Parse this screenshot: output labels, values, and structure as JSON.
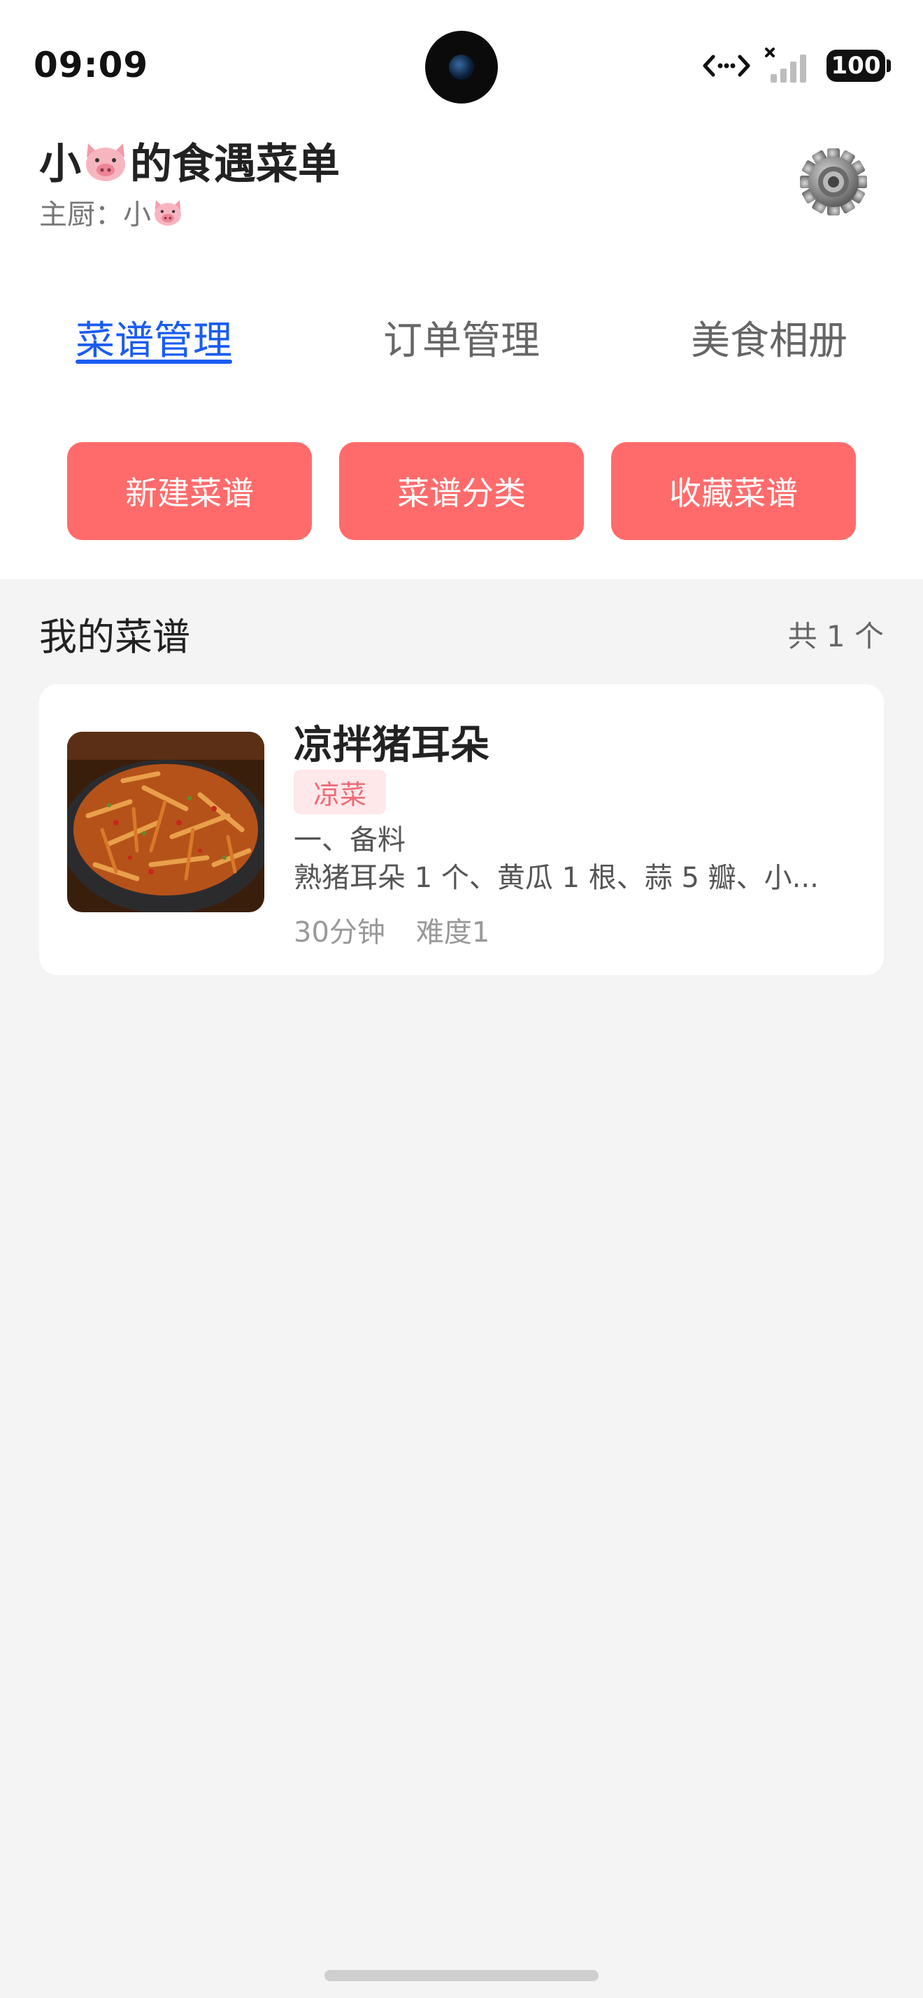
{
  "status_bar": {
    "time": "09:09",
    "battery": "100"
  },
  "header": {
    "title_prefix": "小",
    "title_suffix": "的食遇菜单",
    "chef_label": "主厨：小"
  },
  "tabs": [
    {
      "label": "菜谱管理",
      "active": true
    },
    {
      "label": "订单管理",
      "active": false
    },
    {
      "label": "美食相册",
      "active": false
    }
  ],
  "actions": [
    {
      "label": "新建菜谱"
    },
    {
      "label": "菜谱分类"
    },
    {
      "label": "收藏菜谱"
    }
  ],
  "section": {
    "title": "我的菜谱",
    "count": "共 1 个"
  },
  "recipes": [
    {
      "name": "凉拌猪耳朵",
      "tag": "凉菜",
      "desc_line1": "一、备料",
      "desc_line2": "熟猪耳朵 1 个、黄瓜 1 根、蒜 5 瓣、小...",
      "time": "30分钟",
      "difficulty": "难度1"
    }
  ],
  "colors": {
    "accent": "#1a5cf0",
    "button": "#ff6b6b",
    "tag_bg": "#ffe8ea",
    "tag_text": "#ef6b77",
    "page_bg": "#f4f4f4"
  },
  "icons": [
    "pig-face-icon",
    "gear-icon",
    "network-icon",
    "signal-icon",
    "battery-icon"
  ]
}
